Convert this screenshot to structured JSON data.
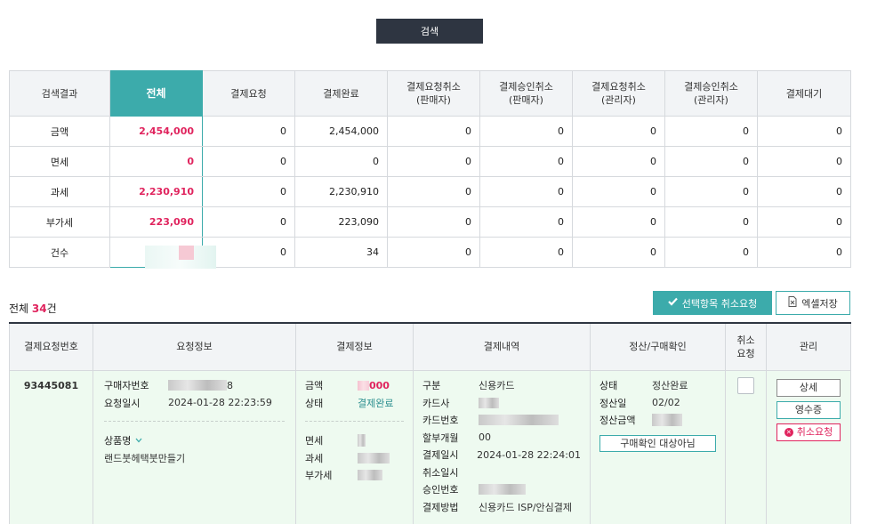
{
  "search": {
    "label": "검색"
  },
  "summary": {
    "headers": [
      "검색결과",
      "전체",
      "결제요청",
      "결제완료",
      "결제요청취소\n(판매자)",
      "결제승인취소\n(판매자)",
      "결제요청취소\n(관리자)",
      "결제승인취소\n(관리자)",
      "결제대기"
    ],
    "rows": [
      {
        "label": "금액",
        "values": [
          "2,454,000",
          "0",
          "2,454,000",
          "0",
          "0",
          "0",
          "0",
          "0"
        ]
      },
      {
        "label": "면세",
        "values": [
          "0",
          "0",
          "0",
          "0",
          "0",
          "0",
          "0",
          "0"
        ]
      },
      {
        "label": "과세",
        "values": [
          "2,230,910",
          "0",
          "2,230,910",
          "0",
          "0",
          "0",
          "0",
          "0"
        ]
      },
      {
        "label": "부가세",
        "values": [
          "223,090",
          "0",
          "223,090",
          "0",
          "0",
          "0",
          "0",
          "0"
        ]
      },
      {
        "label": "건수",
        "values": [
          "",
          "0",
          "34",
          "0",
          "0",
          "0",
          "0",
          "0"
        ]
      }
    ]
  },
  "list": {
    "total_prefix": "전체",
    "total_count": "34",
    "total_suffix": "건",
    "cancel_selected_label": "선택항목 취소요청",
    "excel_label": "엑셀저장",
    "headers": [
      "결제요청번호",
      "요청정보",
      "결제정보",
      "결제내역",
      "정산/구매확인",
      "취소\n요청",
      "관리"
    ]
  },
  "order": {
    "id": "93445081",
    "request": {
      "buyer_label": "구매자번호",
      "buyer_suffix": "8",
      "date_label": "요청일시",
      "date": "2024-01-28 22:23:59",
      "product_label": "상품명",
      "product": "랜드붓헤택붓만들기"
    },
    "payinfo": {
      "amount_label": "금액",
      "amount_tail": "000",
      "status_label": "상태",
      "status": "결제완료",
      "exempt_label": "면세",
      "taxable_label": "과세",
      "vat_label": "부가세"
    },
    "detail": {
      "type_label": "구분",
      "type": "신용카드",
      "card_co_label": "카드사",
      "card_no_label": "카드번호",
      "install_label": "할부개월",
      "install": "00",
      "paydate_label": "결제일시",
      "paydate": "2024-01-28 22:24:01",
      "canceldate_label": "취소일시",
      "approval_label": "승인번호",
      "method_label": "결제방법",
      "method": "신용카드 ISP/안심결제"
    },
    "settle": {
      "status_label": "상태",
      "status": "정산완료",
      "date_label": "정산일",
      "date": "02/02",
      "amount_label": "정산금액",
      "confirm_label": "구매확인 대상아님"
    },
    "manage": {
      "detail_label": "상세",
      "receipt_label": "영수증",
      "cancel_label": "취소요청"
    }
  },
  "colors": {
    "accent": "#3cabab",
    "dark": "#2e3541",
    "alert": "#e0245e",
    "row_bg": "#eefaf0"
  }
}
